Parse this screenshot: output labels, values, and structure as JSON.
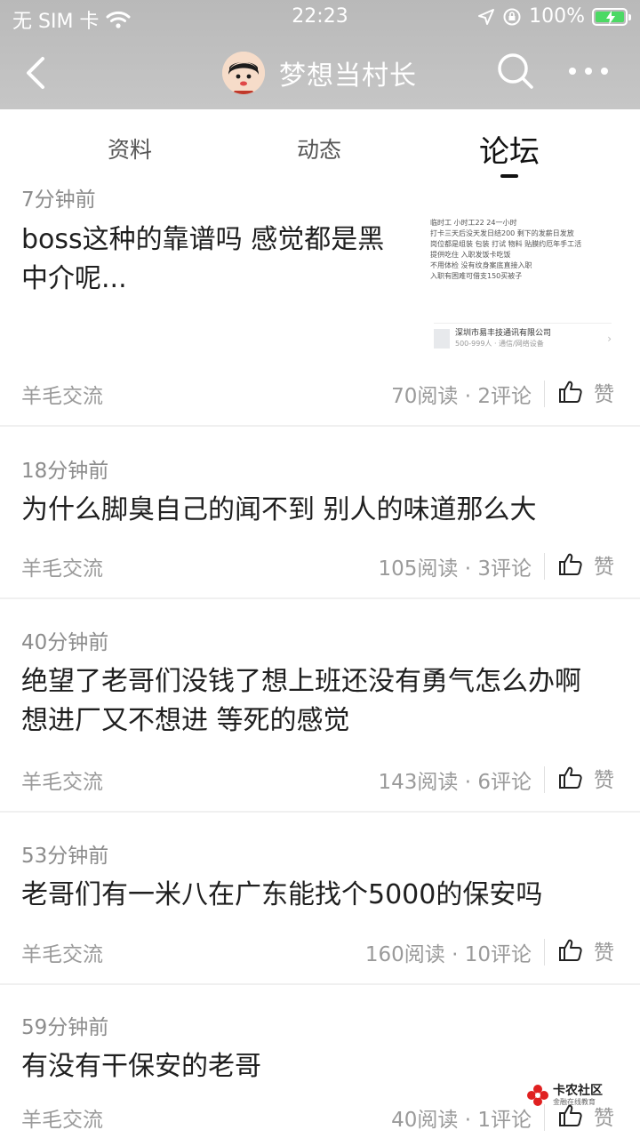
{
  "status_bar": {
    "carrier": "无 SIM 卡",
    "time": "22:23",
    "battery": "100%"
  },
  "header": {
    "title": "梦想当村长",
    "back_icon": "chevron-left-icon",
    "search_icon": "search-icon",
    "more_icon": "more-horizontal-icon"
  },
  "tabs": [
    {
      "label": "资料",
      "active": false
    },
    {
      "label": "动态",
      "active": false
    },
    {
      "label": "论坛",
      "active": true
    }
  ],
  "posts": [
    {
      "time": "7分钟前",
      "title_lines": [
        "boss这种的靠谱吗  感觉都是黑",
        "中介呢..."
      ],
      "category": "羊毛交流",
      "stats": "70阅读 · 2评论",
      "like_label": "赞",
      "thumbnail": {
        "lines": [
          "临时工 小时工22  24一小时",
          "打卡三天后没天发日结200 剩下的发薪日发放",
          "岗位都是组装 包装 打试 物料 贴膜约厄年手工活",
          "提供吃住  入职发饭卡吃饭",
          "不用体检  没有纹身案底直接入职",
          "入职有困难可借支150买被子"
        ],
        "company_name": "深圳市易丰技通讯有限公司",
        "company_info": "500-999人 · 通信/网络设备"
      }
    },
    {
      "time": "18分钟前",
      "title_lines": [
        "为什么脚臭自己的闻不到 别人的味道那么大"
      ],
      "category": "羊毛交流",
      "stats": "105阅读 · 3评论",
      "like_label": "赞"
    },
    {
      "time": "40分钟前",
      "title_lines": [
        "绝望了老哥们没钱了想上班还没有勇气怎么办啊",
        "想进厂又不想进 等死的感觉"
      ],
      "category": "羊毛交流",
      "stats": "143阅读 · 6评论",
      "like_label": "赞"
    },
    {
      "time": "53分钟前",
      "title_lines": [
        "老哥们有一米八在广东能找个5000的保安吗"
      ],
      "category": "羊毛交流",
      "stats": "160阅读 · 10评论",
      "like_label": "赞"
    },
    {
      "time": "59分钟前",
      "title_lines": [
        "有没有干保安的老哥"
      ],
      "category": "羊毛交流",
      "stats": "40阅读 · 1评论",
      "like_label": "赞"
    }
  ],
  "watermark": {
    "name": "卡农社区",
    "sub": "金融在线教育"
  }
}
